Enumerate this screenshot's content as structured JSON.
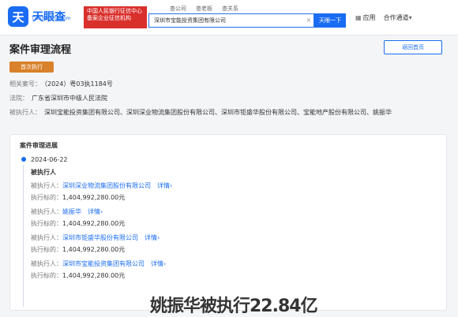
{
  "brand": {
    "mark": "天",
    "name": "天眼查",
    "domain": "TianYanCha.com"
  },
  "promo": {
    "line1": "中国人民银行征信中心",
    "line2": "备案企业征信机构"
  },
  "top_tabs": [
    "查公司",
    "查老板",
    "查关系"
  ],
  "search": {
    "value": "深圳市宝能投资集团有限公司",
    "clear_icon": "×",
    "button": "天眼一下"
  },
  "nav": {
    "app": "应用",
    "cooperation": "合作通道"
  },
  "page": {
    "title": "案件审理流程",
    "home_button": "返回首页"
  },
  "stage": "首次执行",
  "case_info": {
    "case_no_label": "相关案号：",
    "case_no": "（2024）粤03执1184号",
    "court_label": "法院：",
    "court": "广东省深圳市中级人民法院",
    "executed_label": "被执行人：",
    "executed": "深圳宝能投资集团有限公司、深圳深业物流集团股份有限公司、深圳市钜盛华股份有限公司、宝能地产股份有限公司、姚振华"
  },
  "timeline": {
    "title": "案件审理进展",
    "date": "2024-06-22",
    "heading": "被执行人",
    "entries": [
      {
        "name_label": "被执行人：",
        "name": "深圳深业物流集团股份有限公司",
        "detail": "详情",
        "amount_label": "执行标的：",
        "amount": "1,404,992,280.00元"
      },
      {
        "name_label": "被执行人：",
        "name": "姚振华",
        "detail": "详情",
        "amount_label": "执行标的：",
        "amount": "1,404,992,280.00元"
      },
      {
        "name_label": "被执行人：",
        "name": "深圳市钜盛华股份有限公司",
        "detail": "详情",
        "amount_label": "执行标的：",
        "amount": "1,404,992,280.00元"
      },
      {
        "name_label": "被执行人：",
        "name": "深圳市宝能投资集团有限公司",
        "detail": "详情",
        "amount_label": "执行标的：",
        "amount": "1,404,992,280.00元"
      }
    ]
  },
  "overlay_caption": "姚振华被执行22.84亿",
  "colors": {
    "accent": "#1a6cf2",
    "promo": "#d9302c",
    "stage": "#d9822b"
  }
}
